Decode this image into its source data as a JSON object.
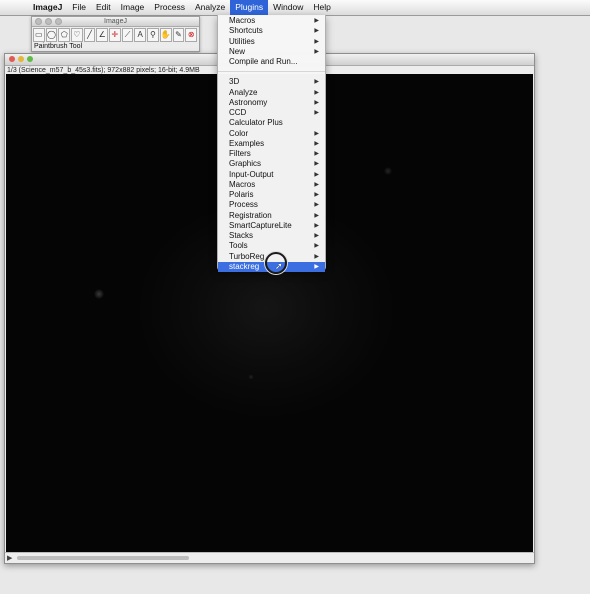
{
  "menubar": {
    "app_name": "ImageJ",
    "items": [
      "File",
      "Edit",
      "Image",
      "Process",
      "Analyze",
      "Plugins",
      "Window",
      "Help"
    ],
    "active": "Plugins"
  },
  "toolbar_window": {
    "title": "ImageJ",
    "status": "Paintbrush Tool"
  },
  "image_window": {
    "info": "1/3 (Science_m57_b_45s3.fits); 972x882 pixels; 16-bit; 4.9MB"
  },
  "plugins_menu": {
    "items": [
      {
        "label": "Macros",
        "submenu": true
      },
      {
        "label": "Shortcuts",
        "submenu": true
      },
      {
        "label": "Utilities",
        "submenu": true
      },
      {
        "label": "New",
        "submenu": true
      },
      {
        "label": "Compile and Run...",
        "submenu": false
      },
      {
        "label": "3D",
        "submenu": true
      },
      {
        "label": "Analyze",
        "submenu": true
      },
      {
        "label": "Astronomy",
        "submenu": true
      },
      {
        "label": "CCD",
        "submenu": true
      },
      {
        "label": "Calculator Plus",
        "submenu": false
      },
      {
        "label": "Color",
        "submenu": true
      },
      {
        "label": "Examples",
        "submenu": true
      },
      {
        "label": "Filters",
        "submenu": true
      },
      {
        "label": "Graphics",
        "submenu": true
      },
      {
        "label": "Input-Output",
        "submenu": true
      },
      {
        "label": "Macros",
        "submenu": true
      },
      {
        "label": "Polaris",
        "submenu": true
      },
      {
        "label": "Process",
        "submenu": true
      },
      {
        "label": "Registration",
        "submenu": true
      },
      {
        "label": "SmartCaptureLite",
        "submenu": true
      },
      {
        "label": "Stacks",
        "submenu": true
      },
      {
        "label": "Tools",
        "submenu": true
      },
      {
        "label": "TurboReg",
        "submenu": true
      },
      {
        "label": "stackreg",
        "submenu": true
      }
    ],
    "highlighted": "stackreg"
  },
  "colors": {
    "menu_highlight": "#3b6ee0",
    "menubar_active": "#2f64d9"
  }
}
